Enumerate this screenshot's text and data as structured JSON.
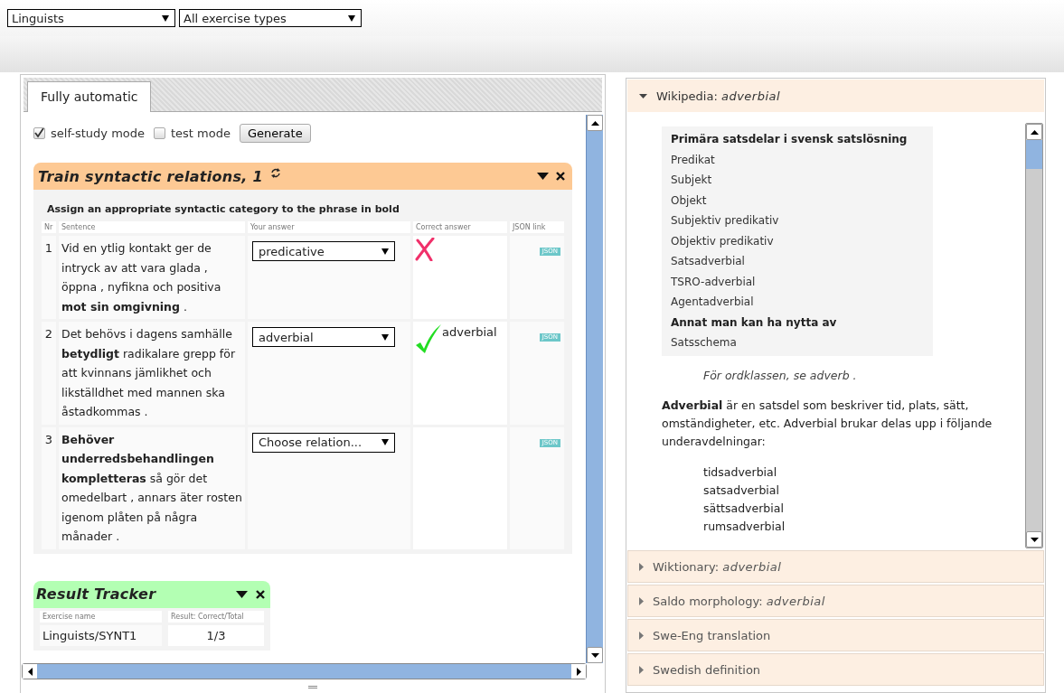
{
  "filters": [
    {
      "value": "Linguists"
    },
    {
      "value": "All exercise types"
    }
  ],
  "tabs": [
    {
      "label": "Fully automatic",
      "selected": true
    }
  ],
  "modes": [
    {
      "label": "self-study mode",
      "checked": true
    },
    {
      "label": "test mode",
      "checked": false
    }
  ],
  "generate_button": "Generate",
  "exercise": {
    "title": "Train syntactic relations, 1",
    "instruction": "Assign an appropriate syntactic category to the phrase in bold",
    "columns": [
      "Nr",
      "Sentence",
      "Your answer",
      "Correct answer",
      "JSON link"
    ],
    "rows": [
      {
        "nr": "1",
        "sentence": "Vid en ytlig kontakt ger de intryck av att vara glada , öppna , nyfikna och positiva **mot sin omgivning** .",
        "answer": "predicative",
        "kind": "wrong",
        "link": "JSON"
      },
      {
        "nr": "2",
        "sentence": "Det behövs i dagens samhälle **betydligt** radikalare grepp för att kvinnans jämlikhet och likställdhet med mannen ska åstadkommas .",
        "answer": "adverbial",
        "kind": "right",
        "correct_answer": "adverbial",
        "link": "JSON"
      },
      {
        "nr": "3",
        "sentence": "**Behöver underredsbehandlingen kompletteras** så gör det omedelbart , annars äter rosten igenom plåten på några månader .",
        "answer": "Choose relation...",
        "kind": "blank",
        "link": "JSON"
      }
    ]
  },
  "tracker": {
    "title": "Result Tracker",
    "columns": [
      "Exercise name",
      "Result: Correct/Total"
    ],
    "rows": [
      {
        "name": "Linguists/SYNT1",
        "result": "1/3"
      }
    ]
  },
  "sections": [
    {
      "label": "Wikipedia:",
      "term": "adverbial",
      "expanded": true
    },
    {
      "label": "Wiktionary:",
      "term": "adverbial",
      "expanded": false
    },
    {
      "label": "Saldo morphology:",
      "term": "adverbial",
      "expanded": false
    },
    {
      "label": "Swe-Eng translation",
      "expanded": false
    },
    {
      "label": "Swedish definition",
      "expanded": false
    }
  ],
  "wiki": {
    "infobox": [
      {
        "kind": "heading",
        "text": "Primära satsdelar i svensk satslösning"
      },
      {
        "kind": "item",
        "text": "Predikat"
      },
      {
        "kind": "item",
        "text": "Subjekt"
      },
      {
        "kind": "item",
        "text": "Objekt"
      },
      {
        "kind": "item",
        "text": "Subjektiv predikativ"
      },
      {
        "kind": "item",
        "text": "Objektiv predikativ"
      },
      {
        "kind": "item",
        "text": "Satsadverbial"
      },
      {
        "kind": "item",
        "text": "TSRO-adverbial"
      },
      {
        "kind": "item",
        "text": "Agentadverbial"
      },
      {
        "kind": "heading",
        "text": "Annat man kan ha nytta av"
      },
      {
        "kind": "item",
        "text": "Satsschema"
      }
    ],
    "hatnote": "För ordklassen, se adverb .",
    "paragraph": "**Adverbial** är en satsdel som beskriver tid, plats, sätt, omständigheter, etc. Adverbial brukar delas upp i följande underavdelningar:",
    "list": [
      "tidsadverbial",
      "satsadverbial",
      "sättsadverbial",
      "rumsadverbial"
    ]
  }
}
